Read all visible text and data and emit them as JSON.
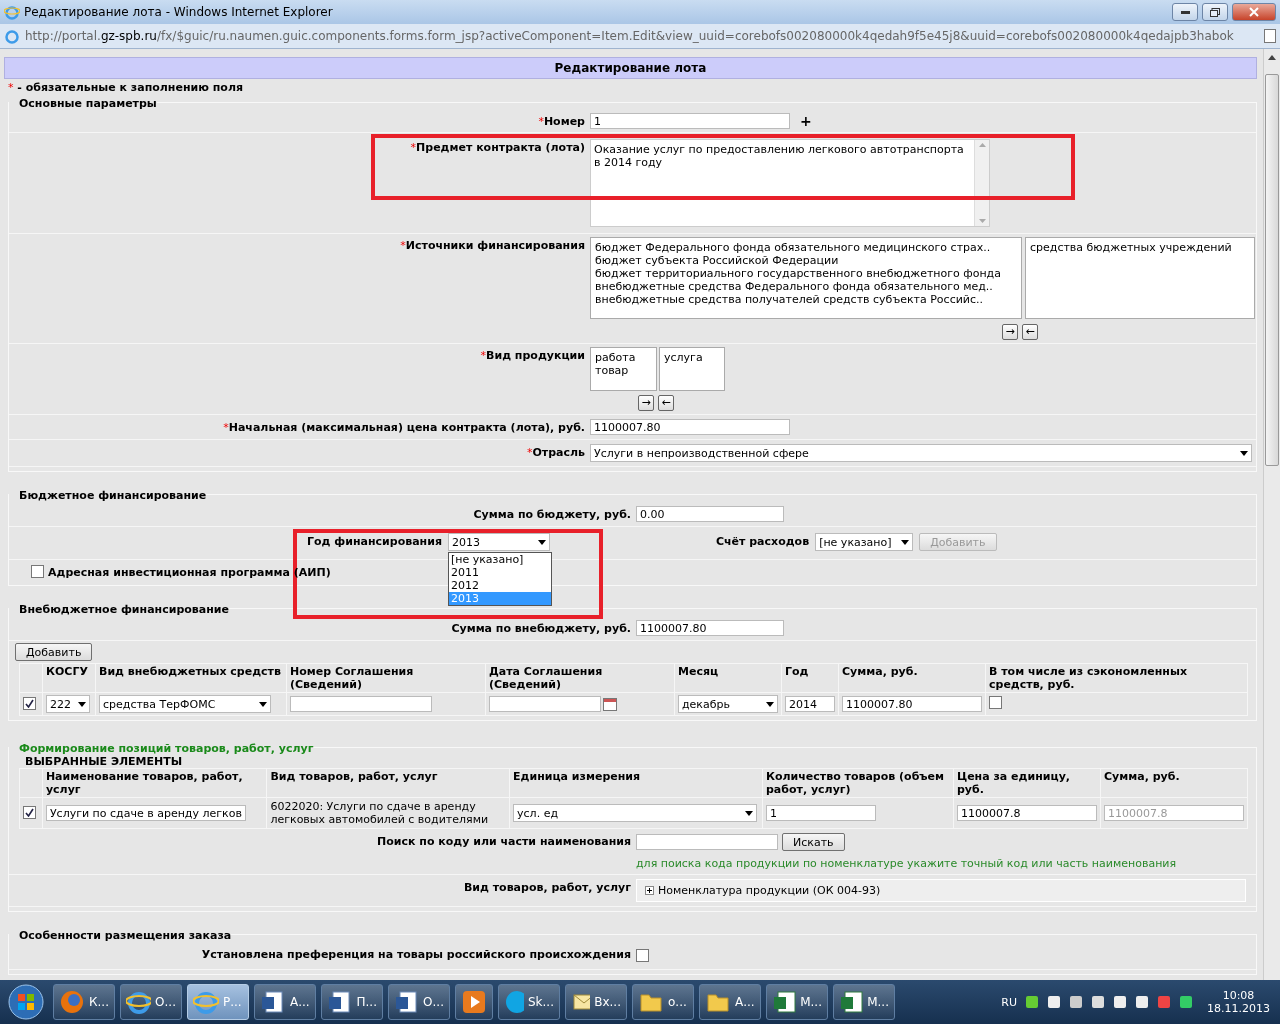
{
  "window": {
    "title": "Редактирование лота - Windows Internet Explorer"
  },
  "address_bar": {
    "url": "http://portal.**gz-spb.ru**/fx/$guic/ru.naumen.guic.components.forms.form_jsp?activeComponent=Item.Edit&view_uuid=corebofs002080000k4qedah9f5e45j8&uuid=corebofs002080000k4qedajpb3habok"
  },
  "page_title": "Редактирование лота",
  "required_mark": "*",
  "required_note": "- обязательные к заполнению поля",
  "main_section": {
    "legend": "Основные параметры",
    "number": {
      "label": "Номер",
      "value": "1",
      "add": "+"
    },
    "subject": {
      "label": "Предмет контракта (лота)",
      "value": "Оказание услуг по предоставлению легкового автотранспорта в 2014 году"
    },
    "sources": {
      "label": "Источники финансирования",
      "available": [
        "бюджет Федерального фонда обязательного медицинского страх..",
        "бюджет субъекта Российской Федерации",
        "бюджет территориального государственного внебюджетного фонда",
        "внебюджетные средства Федерального фонда обязательного мед..",
        "внебюджетные средства получателей средств субъекта Российс.."
      ],
      "chosen": [
        "средства бюджетных учреждений"
      ],
      "move_right": "→",
      "move_left": "←"
    },
    "product_kind": {
      "label": "Вид продукции",
      "available": [
        "работа",
        "товар"
      ],
      "chosen": [
        "услуга"
      ],
      "move_right": "→",
      "move_left": "←"
    },
    "price": {
      "label": "Начальная (максимальная) цена контракта (лота), руб.",
      "value": "1100007.80"
    },
    "industry": {
      "label": "Отрасль",
      "value": "Услуги в непроизводственной сфере"
    }
  },
  "budget_section": {
    "legend": "Бюджетное финансирование",
    "sum": {
      "label": "Сумма по бюджету, руб.",
      "value": "0.00"
    },
    "year": {
      "label": "Год финансирования",
      "value": "2013",
      "options": [
        {
          "label": "[не указано]",
          "selected": false
        },
        {
          "label": "2011",
          "selected": false
        },
        {
          "label": "2012",
          "selected": false
        },
        {
          "label": "2013",
          "selected": true
        }
      ]
    },
    "account": {
      "label": "Счёт расходов",
      "value": "[не указано]",
      "button": "Добавить",
      "button_disabled": true
    },
    "aip": {
      "label": "Адресная инвестиционная программа (АИП)",
      "checked": false
    }
  },
  "offbudget_section": {
    "legend": "Внебюджетное финансирование",
    "sum": {
      "label": "Сумма по внебюджету, руб.",
      "value": "1100007.80"
    },
    "add_button": "Добавить",
    "columns": [
      "КОСГУ",
      "Вид внебюджетных средств",
      "Номер Соглашения (Сведений)",
      "Дата Соглашения (Сведений)",
      "Месяц",
      "Год",
      "Сумма, руб.",
      "В том числе из сэкономленных средств, руб."
    ],
    "rows": [
      {
        "checked": true,
        "kosgu": "222",
        "kind": "средства ТерФОМС",
        "month": "декабрь",
        "year": "2014",
        "sum": "1100007.80",
        "saved_checked": false
      }
    ]
  },
  "positions_section": {
    "legend": "Формирование позиций товаров, работ, услуг",
    "selected_title": "ВЫБРАННЫЕ ЭЛЕМЕНТЫ",
    "columns": [
      "Наименование товаров, работ, услуг",
      "Вид товаров, работ, услуг",
      "Единица измерения",
      "Количество товаров (объем работ, услуг)",
      "Цена за единицу, руб.",
      "Сумма, руб."
    ],
    "rows": [
      {
        "checked": true,
        "name": "Услуги по сдаче в аренду легков",
        "kind": "6022020: Услуги по сдаче в аренду легковых автомобилей с водителями",
        "unit": "усл. ед",
        "quantity": "1",
        "price": "1100007.8",
        "sum": "1100007.8"
      }
    ],
    "search": {
      "label": "Поиск по коду или части наименования",
      "button": "Искать",
      "hint": "для поиска кода продукции по номенклатуре укажите точный код или часть наименования"
    },
    "tree": {
      "label": "Вид товаров, работ, услуг",
      "items": [
        {
          "label": "Номенклатура продукции (ОК 004-93)",
          "expanded": false
        }
      ]
    }
  },
  "placement_section": {
    "legend": "Особенности размещения заказа",
    "preference": {
      "label": "Установлена преференция на товары российского происхождения",
      "checked": false
    }
  },
  "taskbar": {
    "items": [
      {
        "kind": "firefox",
        "label": "К...",
        "active": false
      },
      {
        "kind": "ie",
        "label": "О...",
        "active": false
      },
      {
        "kind": "ie",
        "label": "Р...",
        "active": true
      },
      {
        "kind": "word",
        "label": "А...",
        "active": false
      },
      {
        "kind": "word",
        "label": "П...",
        "active": false
      },
      {
        "kind": "word",
        "label": "О...",
        "active": false
      },
      {
        "kind": "media",
        "active": false
      },
      {
        "kind": "skype",
        "label": "Sk...",
        "active": false
      },
      {
        "kind": "mail",
        "label": "Вх...",
        "active": false
      },
      {
        "kind": "folder",
        "label": "о...",
        "active": false
      },
      {
        "kind": "folder",
        "label": "А...",
        "active": false
      },
      {
        "kind": "excel",
        "label": "М...",
        "active": false
      },
      {
        "kind": "excel",
        "label": "М...",
        "active": false
      }
    ],
    "language": "RU",
    "time": "10:08",
    "date": "18.11.2013"
  }
}
